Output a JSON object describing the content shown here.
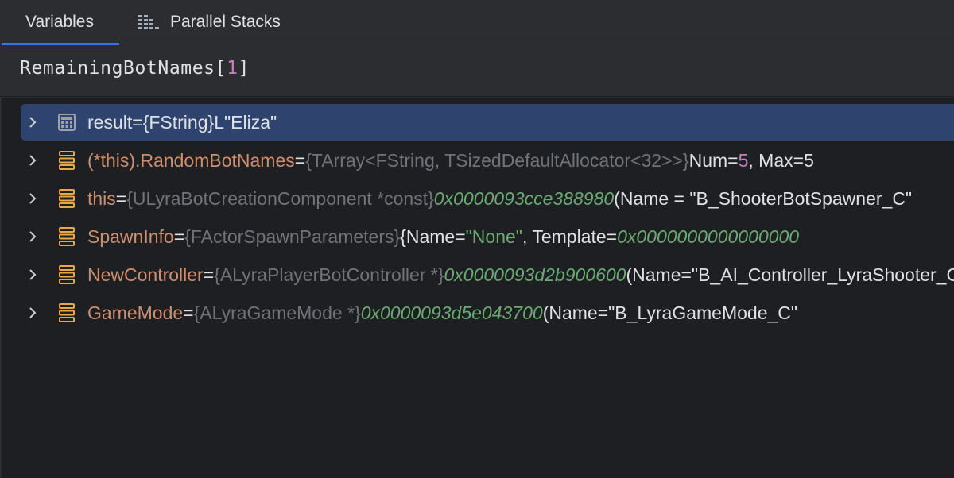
{
  "tabs": {
    "variables": "Variables",
    "parallel_stacks": "Parallel Stacks"
  },
  "expression": {
    "name": "RemainingBotNames[",
    "index": "1",
    "close": "]"
  },
  "rows": [
    {
      "name": "result",
      "eq": " = ",
      "type": "{FString} ",
      "value": "L\"Eliza\"",
      "icon": "calculator-icon",
      "selected": true
    },
    {
      "name": "(*this).RandomBotNames",
      "eq": " = ",
      "type": "{TArray<FString, TSizedDefaultAllocator<32>>} ",
      "v1": "Num=",
      "v2": "5",
      "v3": ", Max=5",
      "icon": "field-icon"
    },
    {
      "name": "this",
      "eq": " = ",
      "type": "{ULyraBotCreationComponent *const} ",
      "addr": "0x0000093cce388980",
      "rest": " (Name = \"B_ShooterBotSpawner_C\"",
      "icon": "field-icon"
    },
    {
      "name": "SpawnInfo",
      "eq": " = ",
      "type": "{FActorSpawnParameters} ",
      "p1": "{Name=",
      "p2": "\"None\"",
      "p3": ", Template=",
      "p4": "0x0000000000000000",
      "icon": "field-icon"
    },
    {
      "name": "NewController",
      "eq": " = ",
      "type": "{ALyraPlayerBotController *} ",
      "addr": "0x0000093d2b900600",
      "rest": " (Name=\"B_AI_Controller_LyraShooter_C\"",
      "icon": "field-icon"
    },
    {
      "name": "GameMode",
      "eq": " = ",
      "type": "{ALyraGameMode *} ",
      "addr": "0x0000093d5e043700",
      "rest": " (Name=\"B_LyraGameMode_C\"",
      "icon": "field-icon"
    }
  ],
  "colors": {
    "selection": "#2e436e",
    "accent": "#3574f0",
    "name": "#cf8e6d",
    "type": "#6f737a",
    "address": "#6aab73",
    "number": "#c77dbb"
  }
}
